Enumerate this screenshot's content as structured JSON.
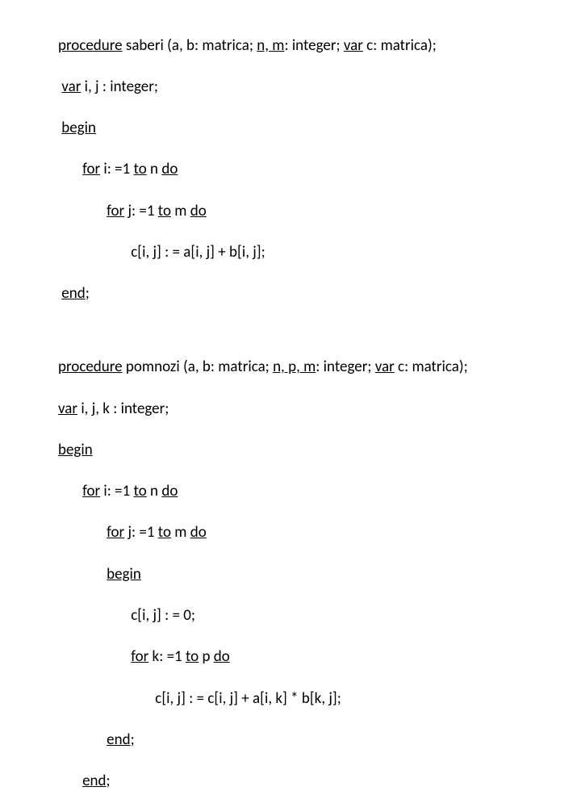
{
  "proc1": {
    "sig_pre": "procedure",
    "sig_rest": " saberi (a, b: matrica; ",
    "sig_nm": "n, m",
    "sig_nm_rest": ": integer; ",
    "sig_var": "var",
    "sig_var_rest": " c: matrica);",
    "var_kw": "var",
    "var_rest": " i, j : integer;",
    "begin": "begin",
    "for1_kw": "for",
    "for1_mid": " i: =1 ",
    "for1_to": "to",
    "for1_rest": " n ",
    "for1_do": "do",
    "for2_kw": "for",
    "for2_mid": " j: =1 ",
    "for2_to": "to",
    "for2_rest": " m ",
    "for2_do": "do",
    "body": "c[i, j] : = a[i, j] + b[i, j];",
    "end": "end",
    "end_semi": ";"
  },
  "proc2": {
    "sig_pre": "procedure",
    "sig_rest": " pomnozi (a, b: matrica; ",
    "sig_npm": "n, p, m",
    "sig_npm_rest": ": integer; ",
    "sig_var": "var",
    "sig_var_rest": " c: matrica);",
    "var_kw": "var",
    "var_rest": " i, j, k : integer;",
    "begin": "begin",
    "for1_kw": "for",
    "for1_mid": " i: =1 ",
    "for1_to": "to",
    "for1_rest": " n ",
    "for1_do": "do",
    "for2_kw": "for",
    "for2_mid": " j: =1 ",
    "for2_to": "to",
    "for2_rest": " m ",
    "for2_do": "do",
    "begin_inner": "begin",
    "body1": "c[i, j] : = 0;",
    "for3_kw": "for",
    "for3_mid": " k: =1 ",
    "for3_to": "to",
    "for3_rest": " p ",
    "for3_do": "do",
    "body2": "c[i, j] : = c[i, j] + a[i, k] * b[k, j];",
    "end_inner": "end",
    "end_inner_semi": ";",
    "end": "end",
    "end_semi": ";"
  }
}
